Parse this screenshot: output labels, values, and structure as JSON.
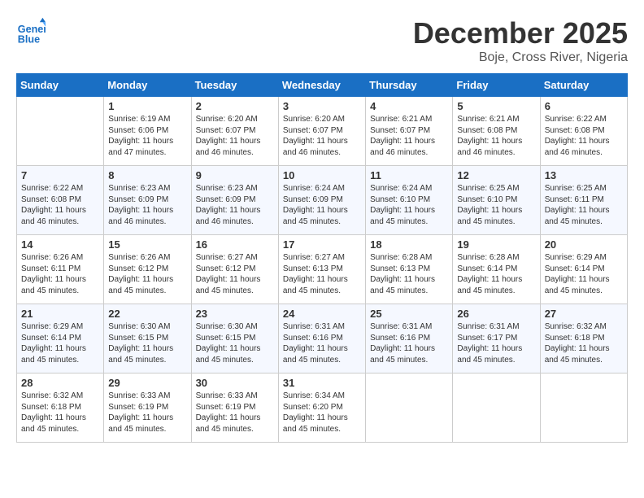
{
  "logo": {
    "line1": "General",
    "line2": "Blue"
  },
  "title": "December 2025",
  "location": "Boje, Cross River, Nigeria",
  "weekdays": [
    "Sunday",
    "Monday",
    "Tuesday",
    "Wednesday",
    "Thursday",
    "Friday",
    "Saturday"
  ],
  "weeks": [
    [
      {
        "day": "",
        "info": ""
      },
      {
        "day": "1",
        "info": "Sunrise: 6:19 AM\nSunset: 6:06 PM\nDaylight: 11 hours\nand 47 minutes."
      },
      {
        "day": "2",
        "info": "Sunrise: 6:20 AM\nSunset: 6:07 PM\nDaylight: 11 hours\nand 46 minutes."
      },
      {
        "day": "3",
        "info": "Sunrise: 6:20 AM\nSunset: 6:07 PM\nDaylight: 11 hours\nand 46 minutes."
      },
      {
        "day": "4",
        "info": "Sunrise: 6:21 AM\nSunset: 6:07 PM\nDaylight: 11 hours\nand 46 minutes."
      },
      {
        "day": "5",
        "info": "Sunrise: 6:21 AM\nSunset: 6:08 PM\nDaylight: 11 hours\nand 46 minutes."
      },
      {
        "day": "6",
        "info": "Sunrise: 6:22 AM\nSunset: 6:08 PM\nDaylight: 11 hours\nand 46 minutes."
      }
    ],
    [
      {
        "day": "7",
        "info": "Sunrise: 6:22 AM\nSunset: 6:08 PM\nDaylight: 11 hours\nand 46 minutes."
      },
      {
        "day": "8",
        "info": "Sunrise: 6:23 AM\nSunset: 6:09 PM\nDaylight: 11 hours\nand 46 minutes."
      },
      {
        "day": "9",
        "info": "Sunrise: 6:23 AM\nSunset: 6:09 PM\nDaylight: 11 hours\nand 46 minutes."
      },
      {
        "day": "10",
        "info": "Sunrise: 6:24 AM\nSunset: 6:09 PM\nDaylight: 11 hours\nand 45 minutes."
      },
      {
        "day": "11",
        "info": "Sunrise: 6:24 AM\nSunset: 6:10 PM\nDaylight: 11 hours\nand 45 minutes."
      },
      {
        "day": "12",
        "info": "Sunrise: 6:25 AM\nSunset: 6:10 PM\nDaylight: 11 hours\nand 45 minutes."
      },
      {
        "day": "13",
        "info": "Sunrise: 6:25 AM\nSunset: 6:11 PM\nDaylight: 11 hours\nand 45 minutes."
      }
    ],
    [
      {
        "day": "14",
        "info": "Sunrise: 6:26 AM\nSunset: 6:11 PM\nDaylight: 11 hours\nand 45 minutes."
      },
      {
        "day": "15",
        "info": "Sunrise: 6:26 AM\nSunset: 6:12 PM\nDaylight: 11 hours\nand 45 minutes."
      },
      {
        "day": "16",
        "info": "Sunrise: 6:27 AM\nSunset: 6:12 PM\nDaylight: 11 hours\nand 45 minutes."
      },
      {
        "day": "17",
        "info": "Sunrise: 6:27 AM\nSunset: 6:13 PM\nDaylight: 11 hours\nand 45 minutes."
      },
      {
        "day": "18",
        "info": "Sunrise: 6:28 AM\nSunset: 6:13 PM\nDaylight: 11 hours\nand 45 minutes."
      },
      {
        "day": "19",
        "info": "Sunrise: 6:28 AM\nSunset: 6:14 PM\nDaylight: 11 hours\nand 45 minutes."
      },
      {
        "day": "20",
        "info": "Sunrise: 6:29 AM\nSunset: 6:14 PM\nDaylight: 11 hours\nand 45 minutes."
      }
    ],
    [
      {
        "day": "21",
        "info": "Sunrise: 6:29 AM\nSunset: 6:14 PM\nDaylight: 11 hours\nand 45 minutes."
      },
      {
        "day": "22",
        "info": "Sunrise: 6:30 AM\nSunset: 6:15 PM\nDaylight: 11 hours\nand 45 minutes."
      },
      {
        "day": "23",
        "info": "Sunrise: 6:30 AM\nSunset: 6:15 PM\nDaylight: 11 hours\nand 45 minutes."
      },
      {
        "day": "24",
        "info": "Sunrise: 6:31 AM\nSunset: 6:16 PM\nDaylight: 11 hours\nand 45 minutes."
      },
      {
        "day": "25",
        "info": "Sunrise: 6:31 AM\nSunset: 6:16 PM\nDaylight: 11 hours\nand 45 minutes."
      },
      {
        "day": "26",
        "info": "Sunrise: 6:31 AM\nSunset: 6:17 PM\nDaylight: 11 hours\nand 45 minutes."
      },
      {
        "day": "27",
        "info": "Sunrise: 6:32 AM\nSunset: 6:18 PM\nDaylight: 11 hours\nand 45 minutes."
      }
    ],
    [
      {
        "day": "28",
        "info": "Sunrise: 6:32 AM\nSunset: 6:18 PM\nDaylight: 11 hours\nand 45 minutes."
      },
      {
        "day": "29",
        "info": "Sunrise: 6:33 AM\nSunset: 6:19 PM\nDaylight: 11 hours\nand 45 minutes."
      },
      {
        "day": "30",
        "info": "Sunrise: 6:33 AM\nSunset: 6:19 PM\nDaylight: 11 hours\nand 45 minutes."
      },
      {
        "day": "31",
        "info": "Sunrise: 6:34 AM\nSunset: 6:20 PM\nDaylight: 11 hours\nand 45 minutes."
      },
      {
        "day": "",
        "info": ""
      },
      {
        "day": "",
        "info": ""
      },
      {
        "day": "",
        "info": ""
      }
    ]
  ]
}
